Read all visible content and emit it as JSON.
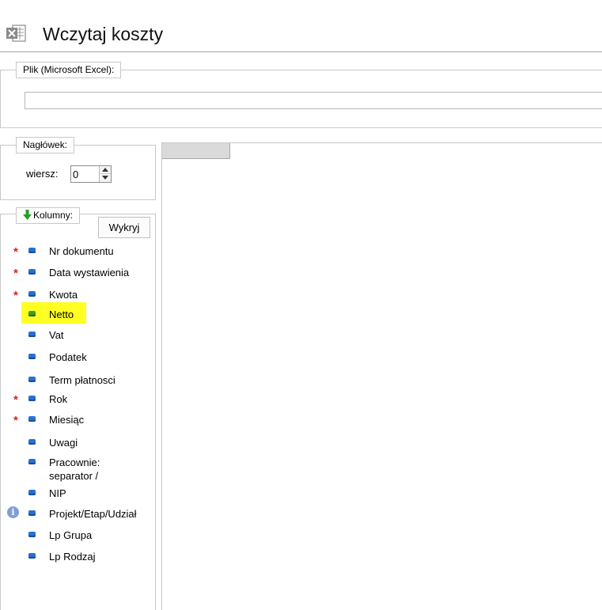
{
  "page": {
    "title": "Wczytaj koszty",
    "icon": "excel-file-icon"
  },
  "file_group": {
    "legend": "Plik (Microsoft Excel):",
    "value": ""
  },
  "header_group": {
    "legend": "Nagłówek:",
    "row_label": "wiersz:",
    "row_value": "0"
  },
  "columns_group": {
    "legend": "Kolumny:",
    "legend_icon": "arrow-down-icon",
    "detect_button": "Wykryj",
    "required_marker": "*",
    "info_marker": "i",
    "highlight_color": "#ffff24",
    "items": [
      {
        "label": "Nr dokumentu",
        "required": true
      },
      {
        "label": "Data wystawienia",
        "required": true
      },
      {
        "label": "Kwota",
        "required": true
      },
      {
        "label": "Netto",
        "required": false,
        "highlighted": true
      },
      {
        "label": "Vat",
        "required": false
      },
      {
        "label": "Podatek",
        "required": false
      },
      {
        "label": "Term płatnosci",
        "required": false
      },
      {
        "label": "Rok",
        "required": true
      },
      {
        "label": "Miesiąc",
        "required": true
      },
      {
        "label": "Uwagi",
        "required": false
      },
      {
        "label": "Pracownie:\nseparator /",
        "required": false
      },
      {
        "label": "NIP",
        "required": false
      },
      {
        "label": "Projekt/Etap/Udział",
        "required": false,
        "info": true
      },
      {
        "label": "Lp Grupa",
        "required": false
      },
      {
        "label": "Lp Rodzaj",
        "required": false
      }
    ]
  },
  "colors": {
    "required": "#e02020",
    "item_icon": "#2a6fd1",
    "highlight_icon": "#3e9a2a",
    "arrow": "#22a022"
  }
}
